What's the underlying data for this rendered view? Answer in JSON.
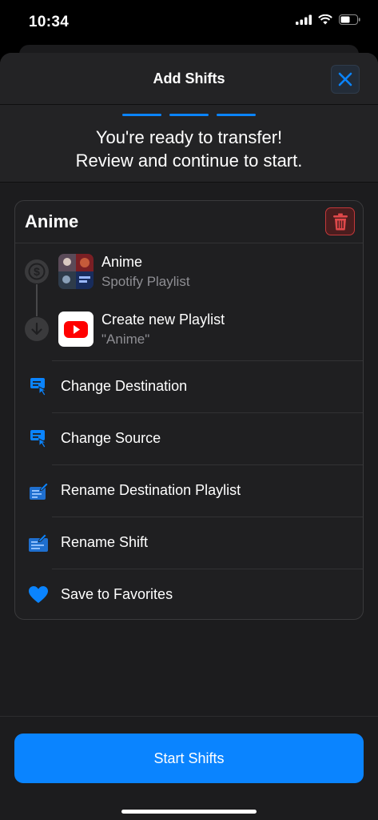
{
  "status_bar": {
    "time": "10:34",
    "icons": [
      "cellular-signal-icon",
      "wifi-icon",
      "battery-icon"
    ]
  },
  "sheet": {
    "title": "Add Shifts",
    "close_icon": "close-icon",
    "steps_total": 3,
    "steps_completed": 3,
    "ready_message_line1": "You're ready to transfer!",
    "ready_message_line2": "Review and continue to start."
  },
  "shift_card": {
    "title": "Anime",
    "delete_icon": "trash-icon",
    "source": {
      "name": "Anime",
      "type": "Spotify Playlist",
      "icon": "spotify-icon"
    },
    "destination": {
      "name": "Create new Playlist",
      "subtitle": "\"Anime\"",
      "icon": "youtube-icon"
    },
    "actions": [
      {
        "label": "Change Destination",
        "icon": "change-destination-icon"
      },
      {
        "label": "Change Source",
        "icon": "change-source-icon"
      },
      {
        "label": "Rename Destination Playlist",
        "icon": "rename-playlist-icon"
      },
      {
        "label": "Rename Shift",
        "icon": "rename-shift-icon"
      },
      {
        "label": "Save to Favorites",
        "icon": "heart-icon"
      }
    ]
  },
  "start_button": {
    "label": "Start Shifts"
  },
  "colors": {
    "accent": "#0a84ff",
    "background": "#1c1c1e",
    "danger": "#c4383a",
    "youtube_red": "#ff0000"
  }
}
